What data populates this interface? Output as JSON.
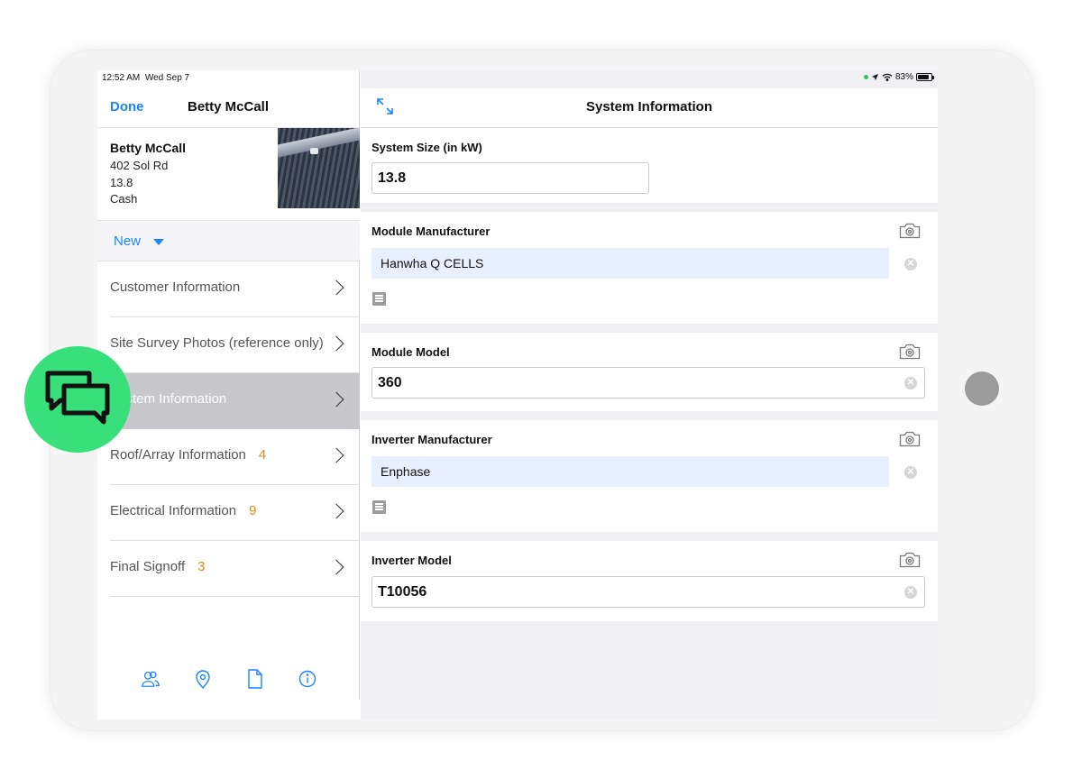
{
  "status_bar": {
    "time": "12:52 AM",
    "date": "Wed Sep 7",
    "battery": "83%",
    "battery_level": 0.83
  },
  "left_pane": {
    "done_label": "Done",
    "title": "Betty McCall",
    "customer": {
      "name": "Betty McCall",
      "address": "402 Sol Rd",
      "system_size": "13.8",
      "payment": "Cash"
    },
    "status_filter": "New",
    "sections": [
      {
        "label": "Customer Information",
        "count": ""
      },
      {
        "label": "Site Survey Photos (reference only)",
        "count": ""
      },
      {
        "label": "System Information",
        "count": "",
        "selected": true
      },
      {
        "label": "Roof/Array Information",
        "count": "4"
      },
      {
        "label": "Electrical Information",
        "count": "9"
      },
      {
        "label": "Final Signoff",
        "count": "3"
      }
    ],
    "toolbar_icons": [
      "contacts-icon",
      "location-pin-icon",
      "document-icon",
      "info-icon"
    ]
  },
  "right_pane": {
    "title": "System Information",
    "fields": {
      "system_size": {
        "label": "System Size (in kW)",
        "value": "13.8"
      },
      "module_manufacturer": {
        "label": "Module Manufacturer",
        "value": "Hanwha Q CELLS"
      },
      "module_model": {
        "label": "Module Model",
        "value": "360"
      },
      "inverter_manufacturer": {
        "label": "Inverter Manufacturer",
        "value": "Enphase"
      },
      "inverter_model": {
        "label": "Inverter Model",
        "value": "T10056"
      }
    }
  },
  "colors": {
    "accent": "#1a85ff",
    "count": "#e08a1c",
    "chat": "#38e07b",
    "picker_bg": "#e8effe"
  }
}
